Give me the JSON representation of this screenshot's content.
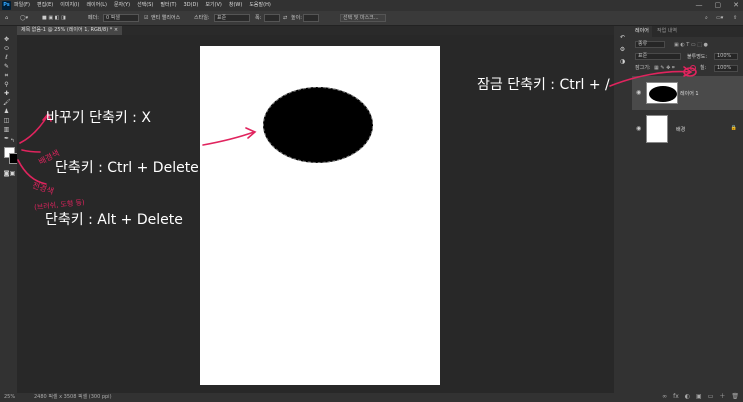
{
  "app": {
    "logo": "Ps",
    "menu": [
      "파일(F)",
      "편집(E)",
      "이미지(I)",
      "레이어(L)",
      "문자(Y)",
      "선택(S)",
      "필터(T)",
      "3D(D)",
      "보기(V)",
      "창(W)",
      "도움말(H)"
    ],
    "window_controls": [
      "—",
      "▢",
      "✕"
    ]
  },
  "options_bar": {
    "feather_label": "페더:",
    "feather_value": "0 픽셀",
    "antialias_label": "앤티 앨리어스",
    "style_label": "스타일:",
    "style_value": "표준",
    "width_label": "폭:",
    "height_label": "높이:",
    "select_mask_button": "선택 및 마스크..."
  },
  "document": {
    "tab_title": "제목 없음-1 @ 25% (레이어 1, RGB/8) *",
    "close": "×",
    "status_zoom": "25%",
    "status_info": "2480 픽셀 x 3508 픽셀 (300 ppi)"
  },
  "layers_panel": {
    "tabs": [
      "레이어",
      "작업 내역"
    ],
    "kind_label": "종류",
    "blend_mode": "표준",
    "opacity_label": "불투명도:",
    "opacity_value": "100%",
    "lock_label": "잠그기:",
    "fill_label": "칠:",
    "fill_value": "100%",
    "layers": [
      {
        "name": "레이어 1",
        "selected": true
      },
      {
        "name": "배경",
        "selected": false
      }
    ],
    "bottom_icons": [
      "∞",
      "fx",
      "◐",
      "▣",
      "▭",
      "＋",
      "🗑"
    ]
  },
  "annotations": {
    "swap_shortcut": "바꾸기 단축키 : X",
    "fill_bg_shortcut": "단축키 : Ctrl + Delete",
    "fill_fg_shortcut": "단축키 : Alt + Delete",
    "lock_shortcut": "잠금 단축키 : Ctrl + /",
    "handwritten_bg": "배경색",
    "handwritten_fg": "전경색",
    "handwritten_fg_sub": "(브러쉬, 도형 등)"
  },
  "colors": {
    "accent": "#e0245e",
    "foreground": "#ffffff",
    "background": "#000000"
  }
}
